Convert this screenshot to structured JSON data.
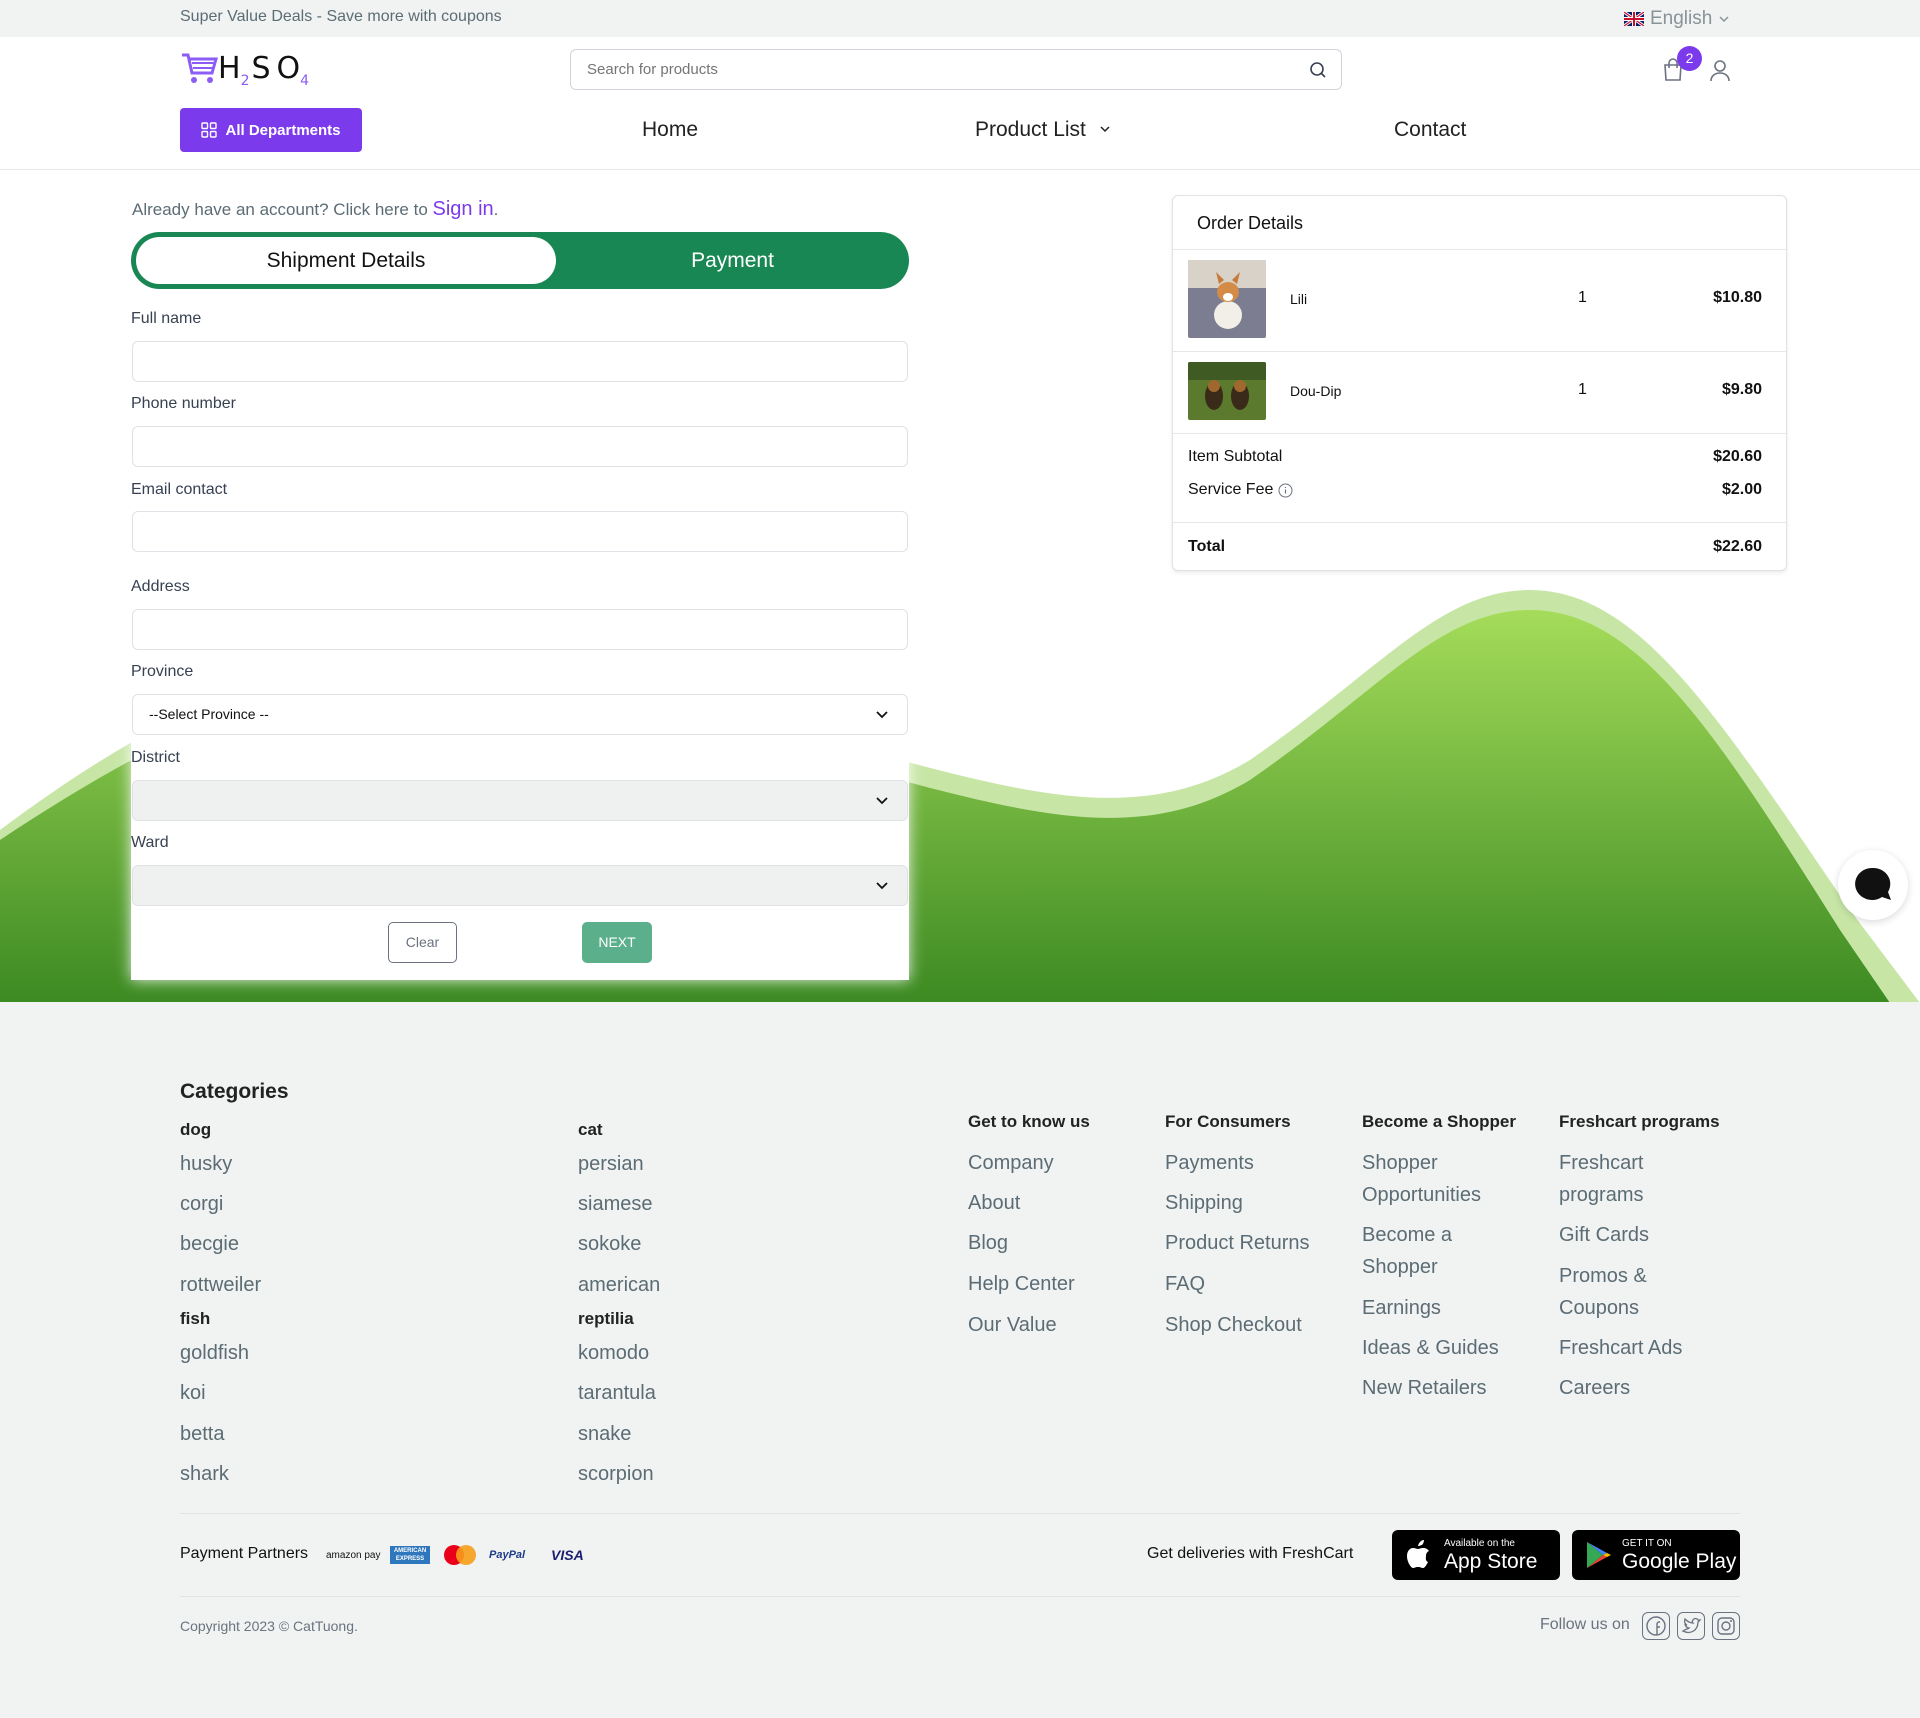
{
  "topbar": {
    "deal": "Super Value Deals - Save more with coupons",
    "language": "English"
  },
  "header": {
    "logo": {
      "h": "H",
      "two": "2",
      "s": "S",
      "o": "O",
      "four": "4"
    },
    "search_placeholder": "Search for products",
    "cart_count": "2",
    "all_departments": "All Departments",
    "nav": {
      "home": "Home",
      "product_list": "Product List",
      "contact": "Contact"
    }
  },
  "checkout": {
    "already_text": "Already have an account? Click here to ",
    "sign_in": "Sign in",
    "tabs": {
      "shipment": "Shipment Details",
      "payment": "Payment"
    },
    "fields": {
      "full_name": "Full name",
      "phone": "Phone number",
      "email": "Email contact",
      "address": "Address",
      "province": "Province",
      "province_value": "--Select Province --",
      "district": "District",
      "ward": "Ward"
    },
    "buttons": {
      "clear": "Clear",
      "next": "NEXT"
    }
  },
  "order": {
    "title": "Order Details",
    "items": [
      {
        "name": "Lili",
        "qty": "1",
        "price": "$10.80"
      },
      {
        "name": "Dou-Dip",
        "qty": "1",
        "price": "$9.80"
      }
    ],
    "subtotal_label": "Item Subtotal",
    "subtotal": "$20.60",
    "fee_label": "Service Fee",
    "fee": "$2.00",
    "total_label": "Total",
    "total": "$22.60"
  },
  "footer": {
    "categories_title": "Categories",
    "categories": [
      {
        "name": "dog",
        "items": [
          "husky",
          "corgi",
          "becgie",
          "rottweiler"
        ]
      },
      {
        "name": "cat",
        "items": [
          "persian",
          "siamese",
          "sokoke",
          "american"
        ]
      },
      {
        "name": "fish",
        "items": [
          "goldfish",
          "koi",
          "betta",
          "shark"
        ]
      },
      {
        "name": "reptilia",
        "items": [
          "komodo",
          "tarantula",
          "snake",
          "scorpion"
        ]
      }
    ],
    "columns": [
      {
        "title": "Get to know us",
        "items": [
          "Company",
          "About",
          "Blog",
          "Help Center",
          "Our Value"
        ]
      },
      {
        "title": "For Consumers",
        "items": [
          "Payments",
          "Shipping",
          "Product Returns",
          "FAQ",
          "Shop Checkout"
        ]
      },
      {
        "title": "Become a Shopper",
        "items": [
          "Shopper Opportunities",
          "Become a Shopper",
          "Earnings",
          "Ideas & Guides",
          "New Retailers"
        ]
      },
      {
        "title": "Freshcart programs",
        "items": [
          "Freshcart programs",
          "Gift Cards",
          "Promos & Coupons",
          "Freshcart Ads",
          "Careers"
        ]
      }
    ],
    "payment_partners": "Payment Partners",
    "pay_logos": {
      "amazon": "amazon pay",
      "amex": "AMERICAN EXPRESS",
      "paypal": "PayPal",
      "visa": "VISA"
    },
    "get_deliveries": "Get deliveries with FreshCart",
    "app_store": {
      "small": "Available on the",
      "big": "App Store"
    },
    "google_play": {
      "small": "GET IT ON",
      "big": "Google Play"
    },
    "copyright": "Copyright 2023 © CatTuong.",
    "follow": "Follow us on"
  },
  "colors": {
    "accent": "#7c3aed",
    "green": "#198754",
    "hill": "#4f9e2a"
  }
}
